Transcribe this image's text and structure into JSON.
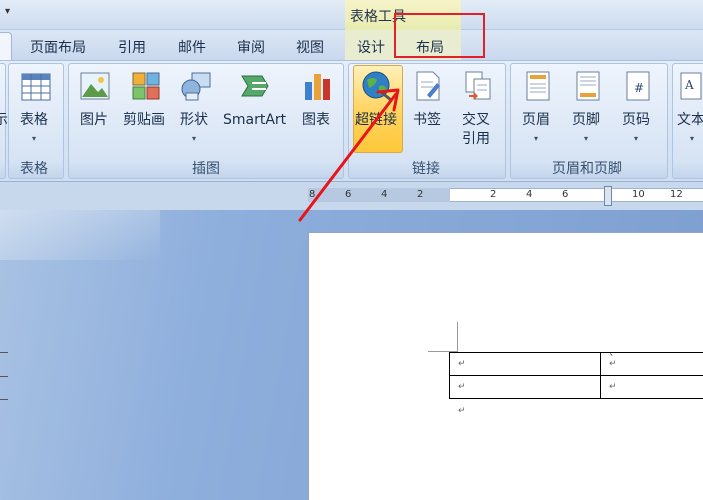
{
  "window": {
    "contextual_group_title": "表格工具"
  },
  "tabs": [
    {
      "label": "页面布局"
    },
    {
      "label": "引用"
    },
    {
      "label": "邮件"
    },
    {
      "label": "审阅"
    },
    {
      "label": "视图"
    },
    {
      "label": "设计"
    },
    {
      "label": "布局"
    }
  ],
  "ribbon": {
    "left_partial": {
      "text": "示"
    },
    "groups": [
      {
        "label": "表格",
        "buttons": [
          {
            "label": "表格"
          }
        ]
      },
      {
        "label": "插图",
        "buttons": [
          {
            "label": "图片"
          },
          {
            "label": "剪贴画"
          },
          {
            "label": "形状"
          },
          {
            "label": "SmartArt"
          },
          {
            "label": "图表"
          }
        ]
      },
      {
        "label": "链接",
        "buttons": [
          {
            "label": "超链接"
          },
          {
            "label": "书签"
          },
          {
            "label": "交叉",
            "label2": "引用"
          }
        ]
      },
      {
        "label": "页眉和页脚",
        "buttons": [
          {
            "label": "页眉"
          },
          {
            "label": "页脚"
          },
          {
            "label": "页码"
          }
        ]
      },
      {
        "label": "",
        "buttons": [
          {
            "label": "文本"
          }
        ]
      }
    ]
  },
  "ruler": {
    "numbers": [
      "8",
      "6",
      "4",
      "2",
      "2",
      "4",
      "6",
      "10",
      "12"
    ]
  },
  "document": {
    "table": [
      [
        "↵",
        "↵"
      ],
      [
        "↵",
        "↵"
      ]
    ],
    "cell_tick": "`",
    "paragraph_mark": "↵"
  },
  "colors": {
    "highlight_box": "#e0202a",
    "arrow": "#e8141c",
    "selected_button": "#ffd35c"
  }
}
